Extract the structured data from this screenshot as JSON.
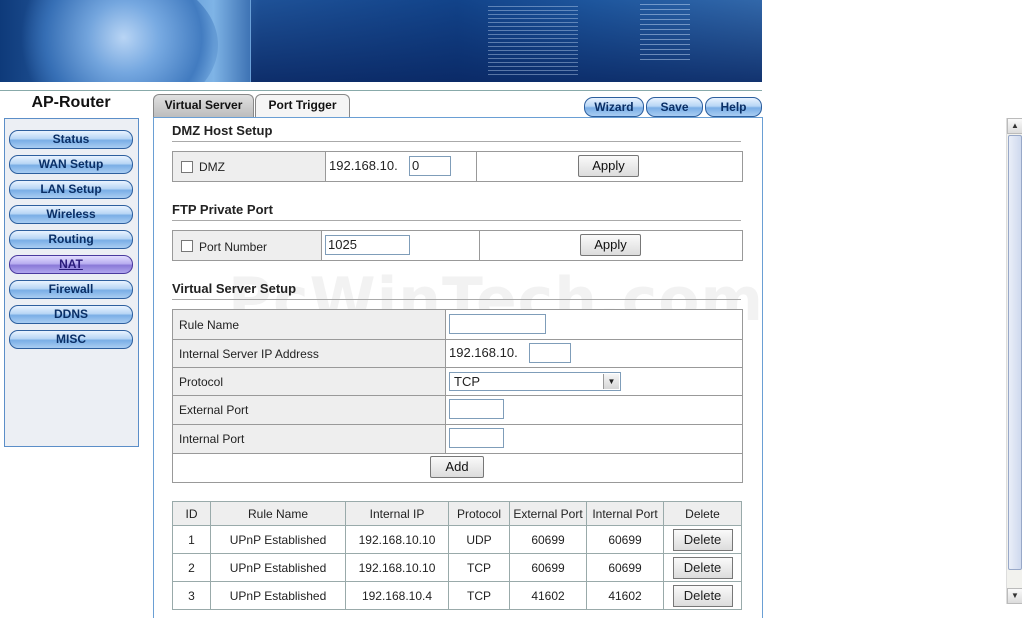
{
  "brand": "AP-Router",
  "sidebar": {
    "items": [
      {
        "label": "Status"
      },
      {
        "label": "WAN Setup"
      },
      {
        "label": "LAN Setup"
      },
      {
        "label": "Wireless"
      },
      {
        "label": "Routing"
      },
      {
        "label": "NAT",
        "active": true
      },
      {
        "label": "Firewall"
      },
      {
        "label": "DDNS"
      },
      {
        "label": "MISC"
      }
    ]
  },
  "tabs": [
    {
      "label": "Virtual Server",
      "active": true
    },
    {
      "label": "Port Trigger",
      "active": false
    }
  ],
  "toolbar": {
    "wizard": "Wizard",
    "save": "Save",
    "help": "Help"
  },
  "dmz": {
    "title": "DMZ Host Setup",
    "checkbox_label": "DMZ",
    "ip_prefix": "192.168.10.",
    "ip_value": "0",
    "apply_label": "Apply"
  },
  "ftp": {
    "title": "FTP Private Port",
    "checkbox_label": "Port Number",
    "port_value": "1025",
    "apply_label": "Apply"
  },
  "virtual_server": {
    "title": "Virtual Server Setup",
    "rule_name_label": "Rule Name",
    "rule_name_value": "",
    "internal_ip_label": "Internal Server IP Address",
    "internal_ip_prefix": "192.168.10.",
    "internal_ip_value": "",
    "protocol_label": "Protocol",
    "protocol_value": "TCP",
    "external_port_label": "External Port",
    "external_port_value": "",
    "internal_port_label": "Internal Port",
    "internal_port_value": "",
    "add_label": "Add"
  },
  "rules_table": {
    "headers": [
      "ID",
      "Rule Name",
      "Internal IP",
      "Protocol",
      "External Port",
      "Internal Port",
      "Delete"
    ],
    "rows": [
      {
        "id": "1",
        "name": "UPnP Established",
        "ip": "192.168.10.10",
        "protocol": "UDP",
        "ext": "60699",
        "int": "60699",
        "action": "Delete"
      },
      {
        "id": "2",
        "name": "UPnP Established",
        "ip": "192.168.10.10",
        "protocol": "TCP",
        "ext": "60699",
        "int": "60699",
        "action": "Delete"
      },
      {
        "id": "3",
        "name": "UPnP Established",
        "ip": "192.168.10.4",
        "protocol": "TCP",
        "ext": "41602",
        "int": "41602",
        "action": "Delete"
      }
    ]
  },
  "watermark": "PcWinTech.com",
  "colors": {
    "accent": "#2d5f9e",
    "panel_border": "#6a9fd4",
    "active_nav": "#8a7ad8"
  }
}
